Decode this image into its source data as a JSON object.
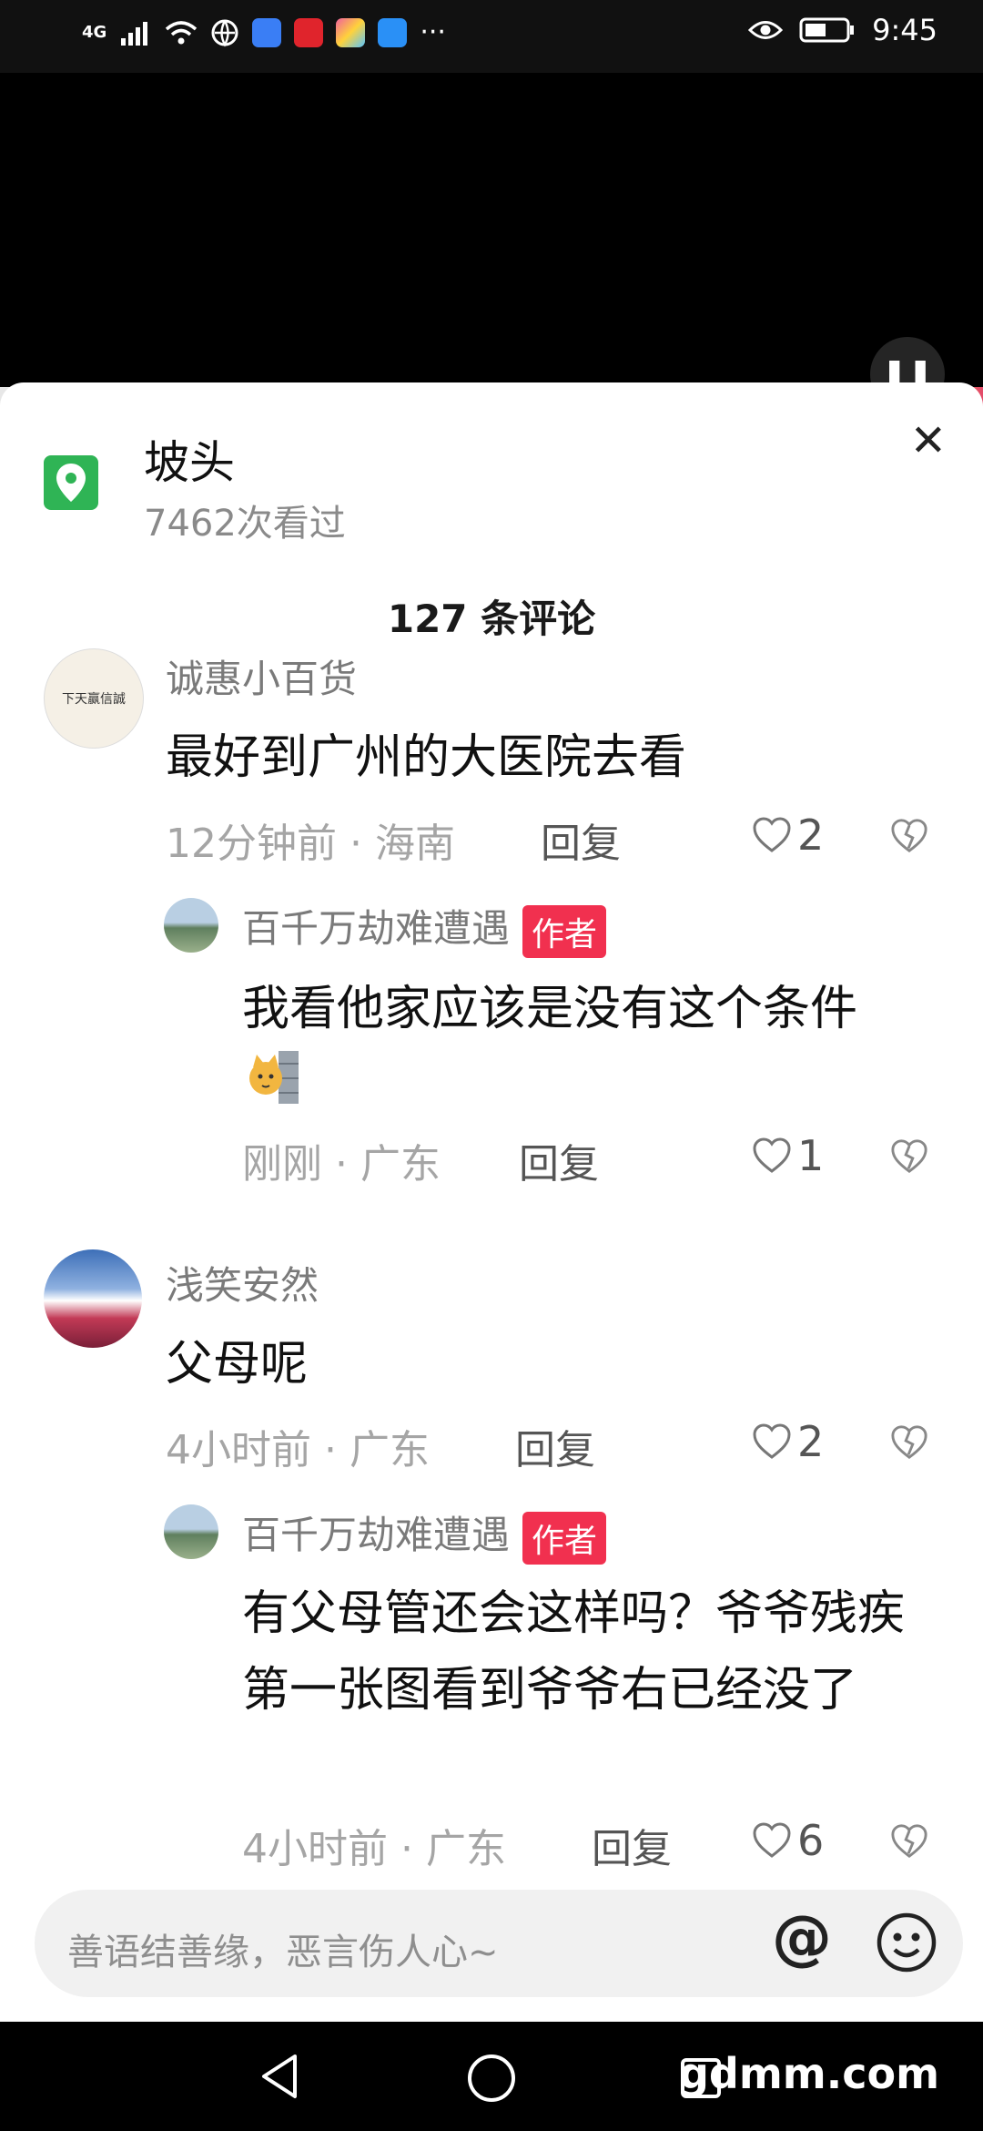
{
  "status_bar": {
    "network": "4G",
    "time": "9:45",
    "icons": [
      "signal-icon",
      "wifi-icon",
      "globe-icon",
      "music-app-icon",
      "red-app-icon",
      "colorful-app-icon",
      "weather-app-icon",
      "more-icon",
      "eye-icon",
      "battery-icon"
    ]
  },
  "video": {
    "pause_icon": "pause-icon"
  },
  "sheet": {
    "location": {
      "title": "坡头",
      "views": "7462次看过",
      "icon": "map-pin-icon"
    },
    "close_icon": "close-icon",
    "comment_count": "127 条评论",
    "comments": [
      {
        "username": "诚惠小百货",
        "text": "最好到广州的大医院去看",
        "time": "12分钟前",
        "region": "海南",
        "reply_label": "回复",
        "likes": "2",
        "avatar_text": "下天赢信誠",
        "replies": [
          {
            "username": "百千万劫难遭遇",
            "badge": "作者",
            "text": "我看他家应该是没有这个条件",
            "emoji": "cat-peeking-emoji",
            "time": "刚刚",
            "region": "广东",
            "reply_label": "回复",
            "likes": "1"
          }
        ]
      },
      {
        "username": "浅笑安然",
        "text": "父母呢",
        "time": "4小时前",
        "region": "广东",
        "reply_label": "回复",
        "likes": "2",
        "replies": [
          {
            "username": "百千万劫难遭遇",
            "badge": "作者",
            "text": "有父母管还会这样吗？爷爷残疾第一张图看到爷爷右已经没了",
            "time": "4小时前",
            "region": "广东",
            "reply_label": "回复",
            "likes": "6"
          }
        ]
      }
    ]
  },
  "input": {
    "placeholder": "善语结善缘，恶言伤人心~",
    "mention_icon": "@"
  },
  "nav": {
    "watermark": "gdmm.com"
  },
  "colors": {
    "accent": "#f1304f",
    "location": "#2fb455",
    "secondary": "#a5a5a5"
  }
}
